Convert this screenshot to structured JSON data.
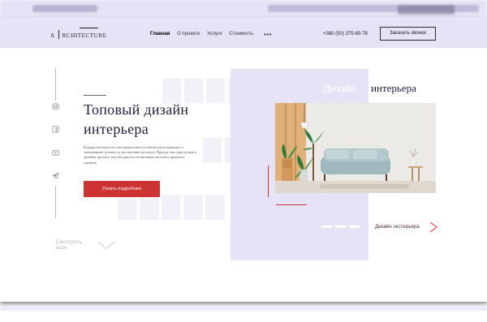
{
  "header": {
    "logo_letter": "A",
    "logo_rest": "RCHITECTURE",
    "nav": [
      "Главная",
      "О проекте",
      "Услуги",
      "Стоимость"
    ],
    "more_icon": "•••",
    "phone": "+380 (50) 375-65-78",
    "order_label": "Заказать звонок"
  },
  "hero": {
    "headline_line1": "Топовый дизайн",
    "headline_line2": "интерьера",
    "description": "Каждая неточность и неопределенность обязательно приведет к затягиванию сроков и к увеличению расходов. Прежде чем приступить к дизайну проекта, мы обсудим все возможные мелочи и придем к единому.",
    "cta_label": "Узнать подробнее",
    "see_more_line1": "Смотреть",
    "see_more_line2": "еще"
  },
  "showcase": {
    "title_light": "Дизайн",
    "title_dark": "интерьера",
    "exterior_link": "Дизайн экстерьера"
  },
  "social_icons": [
    "instagram-icon",
    "facebook-icon",
    "youtube-icon",
    "telegram-icon"
  ],
  "colors": {
    "accent_red": "#cc3333",
    "lavender": "#e6e3f7",
    "navy_text": "#1f1e3d"
  }
}
